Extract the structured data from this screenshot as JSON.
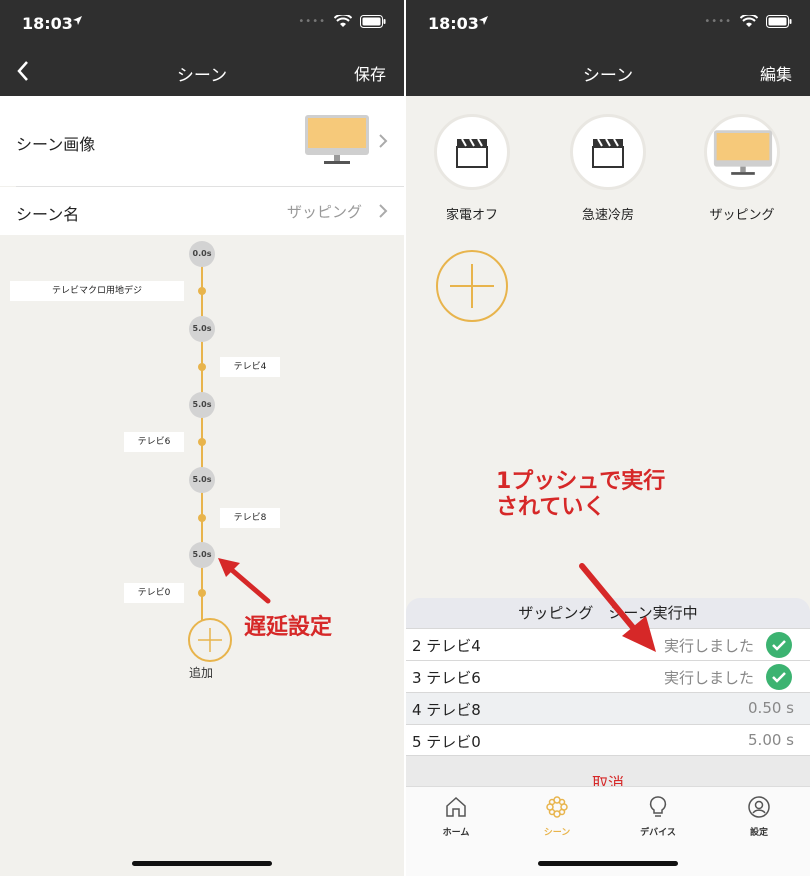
{
  "status_time": "18:03",
  "left": {
    "nav_title": "シーン",
    "nav_right": "保存",
    "scene_image_label": "シーン画像",
    "scene_name_label": "シーン名",
    "scene_name_value": "ザッピング",
    "timeline": [
      {
        "kind": "delay",
        "label": "0.0s"
      },
      {
        "kind": "action",
        "label": "テレビマクロ用地デジ"
      },
      {
        "kind": "delay",
        "label": "5.0s"
      },
      {
        "kind": "action",
        "label": "テレビ4"
      },
      {
        "kind": "delay",
        "label": "5.0s"
      },
      {
        "kind": "action",
        "label": "テレビ6"
      },
      {
        "kind": "delay",
        "label": "5.0s"
      },
      {
        "kind": "action",
        "label": "テレビ8"
      },
      {
        "kind": "delay",
        "label": "5.0s"
      },
      {
        "kind": "action",
        "label": "テレビ0"
      }
    ],
    "add_label": "追加",
    "annotation": "遅延設定"
  },
  "right": {
    "nav_title": "シーン",
    "nav_right": "編集",
    "scenes": [
      {
        "label": "家電オフ",
        "icon": "clapperboard-icon"
      },
      {
        "label": "急速冷房",
        "icon": "clapperboard-icon"
      },
      {
        "label": "ザッピング",
        "icon": "tv-icon"
      }
    ],
    "annotation_line1": "1プッシュで実行",
    "annotation_line2": "されていく",
    "exec_title": "ザッピング　シーン実行中",
    "exec_rows": [
      {
        "name": "2 テレビ4",
        "status": "実行しました",
        "done": true
      },
      {
        "name": "3 テレビ6",
        "status": "実行しました",
        "done": true
      },
      {
        "name": "4 テレビ8",
        "status": "0.50 s",
        "done": false
      },
      {
        "name": "5 テレビ0",
        "status": "5.00 s",
        "done": false
      }
    ],
    "cancel_label": "取消",
    "tabs": [
      {
        "label": "ホーム",
        "icon": "home-icon",
        "active": false
      },
      {
        "label": "シーン",
        "icon": "scene-flower-icon",
        "active": true
      },
      {
        "label": "デバイス",
        "icon": "bulb-icon",
        "active": false
      },
      {
        "label": "設定",
        "icon": "user-settings-icon",
        "active": false
      }
    ]
  },
  "colors": {
    "accent": "#e8b44c",
    "bar": "#2f2f2f",
    "background": "#f2f1ed",
    "annotation_red": "#d62828",
    "check_green": "#3cb371"
  }
}
